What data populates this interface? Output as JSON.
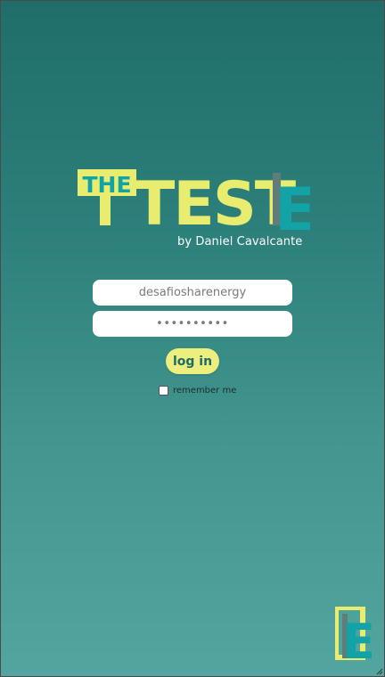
{
  "brand": {
    "logo_the": "THE",
    "logo_main": "TEST",
    "logo_e": "E",
    "tagline": "by Daniel Cavalcante",
    "colors": {
      "yellow": "#e8ec6f",
      "teal": "#12a3a6",
      "gray": "#607d79",
      "background_top": "#1f6e6a",
      "background_bottom": "#53a59f"
    }
  },
  "login": {
    "username_value": "desafiosharenergy",
    "password_value": "••••••••••",
    "submit_label": "log in",
    "remember_label": "remember me",
    "remember_checked": false
  },
  "footer": {
    "logo_letter": "E"
  }
}
